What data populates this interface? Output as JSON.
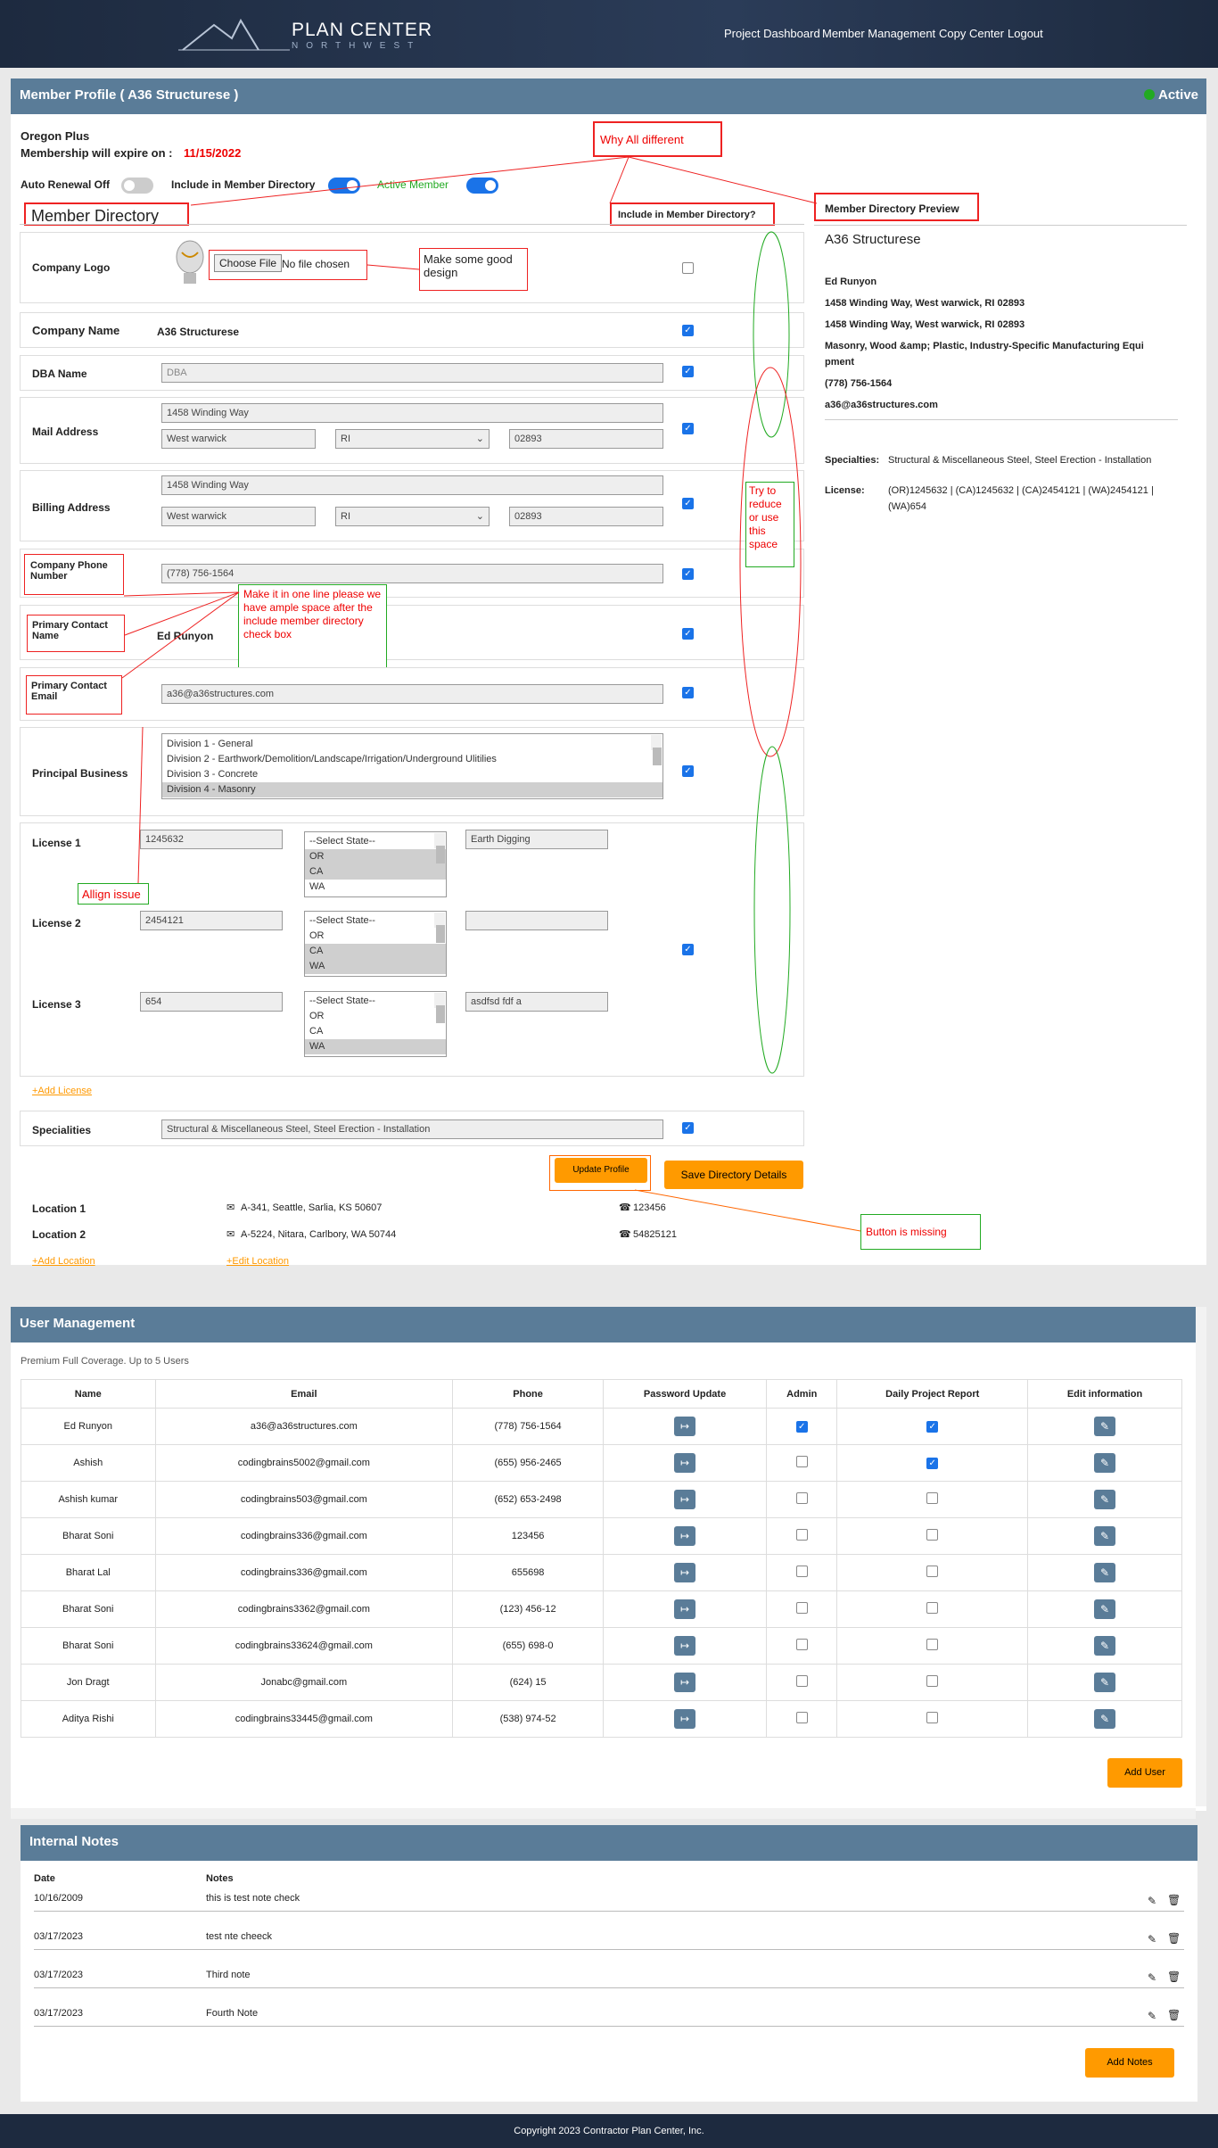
{
  "header": {
    "brand": "PLAN CENTER",
    "brand_sub": "NORTHWEST",
    "nav": [
      "Project Dashboard",
      "Member Management",
      "Copy Center",
      "Logout"
    ]
  },
  "profile": {
    "title": "Member Profile ( A36 Structurese )",
    "status": "Active",
    "plan": "Oregon Plus",
    "expire_label": "Membership will expire on :",
    "expire_date": "11/15/2022",
    "auto_renewal": "Auto Renewal Off",
    "include_dir": "Include in Member Directory",
    "active_member": "Active Member",
    "section_title": "Member Directory",
    "include_col": "Include in Member Directory?",
    "company_logo": "Company Logo",
    "choose_file": "Choose File",
    "no_file": "No file chosen",
    "company_name_label": "Company Name",
    "company_name": "A36 Structurese",
    "dba_label": "DBA Name",
    "dba_placeholder": "DBA",
    "mail_label": "Mail Address",
    "mail_street": "1458 Winding Way",
    "mail_city": "West warwick",
    "mail_state": "RI",
    "mail_zip": "02893",
    "billing_label": "Billing Address",
    "bill_street": "1458 Winding Way",
    "bill_city": "West warwick",
    "bill_state": "RI",
    "bill_zip": "02893",
    "phone_label": "Company Phone Number",
    "phone": "(778) 756-1564",
    "contact_label": "Primary Contact Name",
    "contact": "Ed Runyon",
    "email_label": "Primary Contact Email",
    "email": "a36@a36structures.com",
    "business_label": "Principal Business",
    "business_options": [
      "Division 1 - General",
      "Division 2 - Earthwork/Demolition/Landscape/Irrigation/Underground Ulitilies",
      "Division 3 - Concrete",
      "Division 4 - Masonry"
    ],
    "licenses": [
      {
        "label": "License 1",
        "number": "1245632",
        "desc": "Earth Digging"
      },
      {
        "label": "License 2",
        "number": "2454121",
        "desc": ""
      },
      {
        "label": "License 3",
        "number": "654",
        "desc": "asdfsd fdf a"
      }
    ],
    "state_options": [
      "--Select State--",
      "OR",
      "CA",
      "WA"
    ],
    "add_license": "+Add License",
    "spec_label": "Specialities",
    "spec": "Structural & Miscellaneous Steel, Steel Erection - Installation",
    "update_btn": "Update Profile",
    "save_btn": "Save Directory Details",
    "locations": [
      {
        "label": "Location 1",
        "addr": "A-341, Seattle, Sarlia, KS 50607",
        "phone": "123456"
      },
      {
        "label": "Location 2",
        "addr": "A-5224, Nitara, Carlbory, WA 50744",
        "phone": "54825121"
      }
    ],
    "add_location": "+Add Location",
    "edit_location": "+Edit Location"
  },
  "preview": {
    "title": "Member Directory Preview",
    "company": "A36 Structurese",
    "lines": [
      "Ed Runyon",
      "1458 Winding Way, West warwick, RI 02893",
      "1458 Winding Way, West warwick, RI 02893",
      "Masonry, Wood &amp; Plastic, Industry-Specific Manufacturing Equi",
      "pment",
      "(778) 756-1564",
      "a36@a36structures.com"
    ],
    "spec_label": "Specialties:",
    "spec": "Structural & Miscellaneous Steel, Steel Erection - Installation",
    "lic_label": "License:",
    "lic1": "(OR)1245632 | (CA)1245632 | (CA)2454121 | (WA)2454121 |",
    "lic2": "(WA)654"
  },
  "annotations": {
    "why": "Why All different",
    "design": "Make some good design",
    "reduce": "Try to reduce or use this space",
    "oneline": "Make it in one line please we have ample space after the include member directory check box",
    "allign": "Allign issue",
    "missing": "Button is missing"
  },
  "users": {
    "title": "User Management",
    "coverage": "Premium Full Coverage. Up to 5 Users",
    "cols": [
      "Name",
      "Email",
      "Phone",
      "Password Update",
      "Admin",
      "Daily Project Report",
      "Edit information"
    ],
    "rows": [
      [
        "Ed Runyon",
        "a36@a36structures.com",
        "(778) 756-1564",
        true,
        true
      ],
      [
        "Ashish",
        "codingbrains5002@gmail.com",
        "(655) 956-2465",
        false,
        true
      ],
      [
        "Ashish kumar",
        "codingbrains503@gmail.com",
        "(652) 653-2498",
        false,
        false
      ],
      [
        "Bharat Soni",
        "codingbrains336@gmail.com",
        "123456",
        false,
        false
      ],
      [
        "Bharat Lal",
        "codingbrains336@gmail.com",
        "655698",
        false,
        false
      ],
      [
        "Bharat Soni",
        "codingbrains3362@gmail.com",
        "(123) 456-12",
        false,
        false
      ],
      [
        "Bharat Soni",
        "codingbrains33624@gmail.com",
        "(655) 698-0",
        false,
        false
      ],
      [
        "Jon Dragt",
        "Jonabc@gmail.com",
        "(624) 15",
        false,
        false
      ],
      [
        "Aditya Rishi",
        "codingbrains33445@gmail.com",
        "(538) 974-52",
        false,
        false
      ]
    ],
    "add_btn": "Add User"
  },
  "notes": {
    "title": "Internal Notes",
    "col_date": "Date",
    "col_notes": "Notes",
    "rows": [
      [
        "10/16/2009",
        "this is test note check"
      ],
      [
        "03/17/2023",
        "test nte cheeck"
      ],
      [
        "03/17/2023",
        "Third note"
      ],
      [
        "03/17/2023",
        "Fourth Note"
      ]
    ],
    "add_btn": "Add Notes"
  },
  "footer": "Copyright 2023 Contractor Plan Center, Inc."
}
